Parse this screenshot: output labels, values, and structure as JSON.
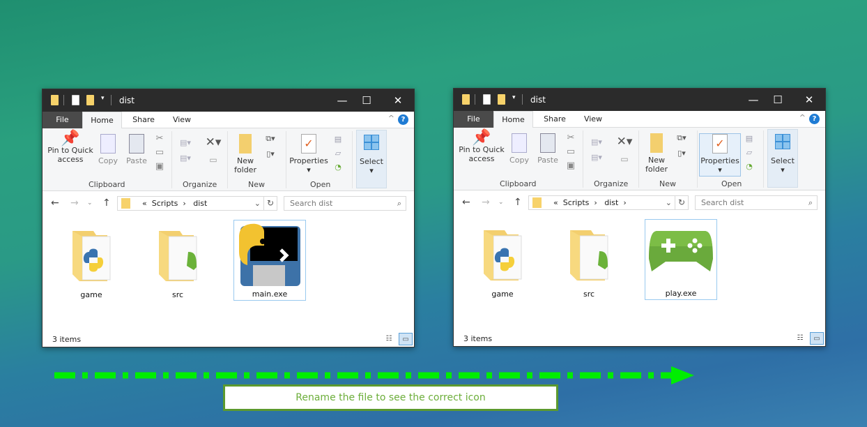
{
  "windows": [
    {
      "title": "dist",
      "tabs": {
        "file": "File",
        "home": "Home",
        "share": "Share",
        "view": "View"
      },
      "ribbon": {
        "pin": "Pin to Quick access",
        "copy": "Copy",
        "paste": "Paste",
        "clipboard": "Clipboard",
        "organize": "Organize",
        "new_folder": "New folder",
        "new": "New",
        "properties": "Properties",
        "open": "Open",
        "select": "Select"
      },
      "address": {
        "prefix": "«",
        "crumbs": [
          "Scripts",
          "dist"
        ],
        "search_placeholder": "Search dist"
      },
      "items": [
        {
          "name": "game",
          "icon": "folder-python"
        },
        {
          "name": "src",
          "icon": "folder-gamepad"
        },
        {
          "name": "main.exe",
          "icon": "python-floppy",
          "selected": true
        }
      ],
      "status": "3 items"
    },
    {
      "title": "dist",
      "tabs": {
        "file": "File",
        "home": "Home",
        "share": "Share",
        "view": "View"
      },
      "ribbon": {
        "pin": "Pin to Quick access",
        "copy": "Copy",
        "paste": "Paste",
        "clipboard": "Clipboard",
        "organize": "Organize",
        "new_folder": "New folder",
        "new": "New",
        "properties": "Properties",
        "open": "Open",
        "select": "Select"
      },
      "address": {
        "prefix": "«",
        "crumbs": [
          "Scripts",
          "dist"
        ],
        "search_placeholder": "Search dist"
      },
      "items": [
        {
          "name": "game",
          "icon": "folder-python"
        },
        {
          "name": "src",
          "icon": "folder-gamepad"
        },
        {
          "name": "play.exe",
          "icon": "gamepad",
          "selected": true
        }
      ],
      "status": "3 items"
    }
  ],
  "caption": "Rename the file to see the correct icon",
  "colors": {
    "arrow": "#00ee00",
    "caption_border": "#5c9a2e",
    "caption_text": "#6cae3a"
  }
}
